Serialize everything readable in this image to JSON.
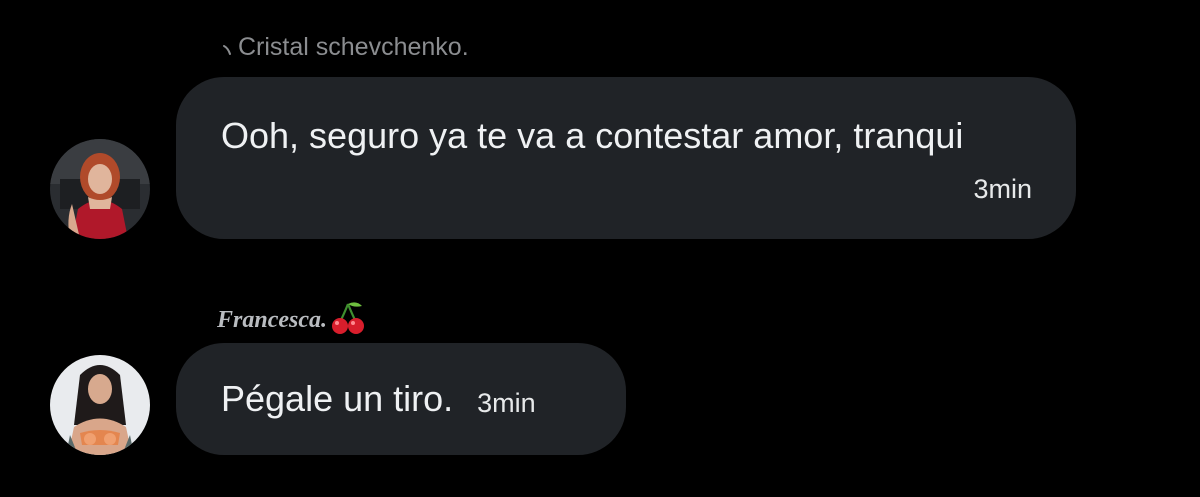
{
  "messages": [
    {
      "sender": "Cristal schevchenko.",
      "text": "Ooh, seguro ya te va a contestar amor, tranqui",
      "time": "3min",
      "avatar_icon": "woman-red-dress-avatar"
    },
    {
      "sender": "Francesca.",
      "sender_emoji": "cherry-emoji",
      "text": "Pégale un tiro.",
      "time": "3min",
      "avatar_icon": "woman-tattoo-avatar"
    }
  ],
  "colors": {
    "background": "#000000",
    "bubble": "#202327",
    "text": "#eff1f3",
    "muted": "#8b8d90"
  }
}
